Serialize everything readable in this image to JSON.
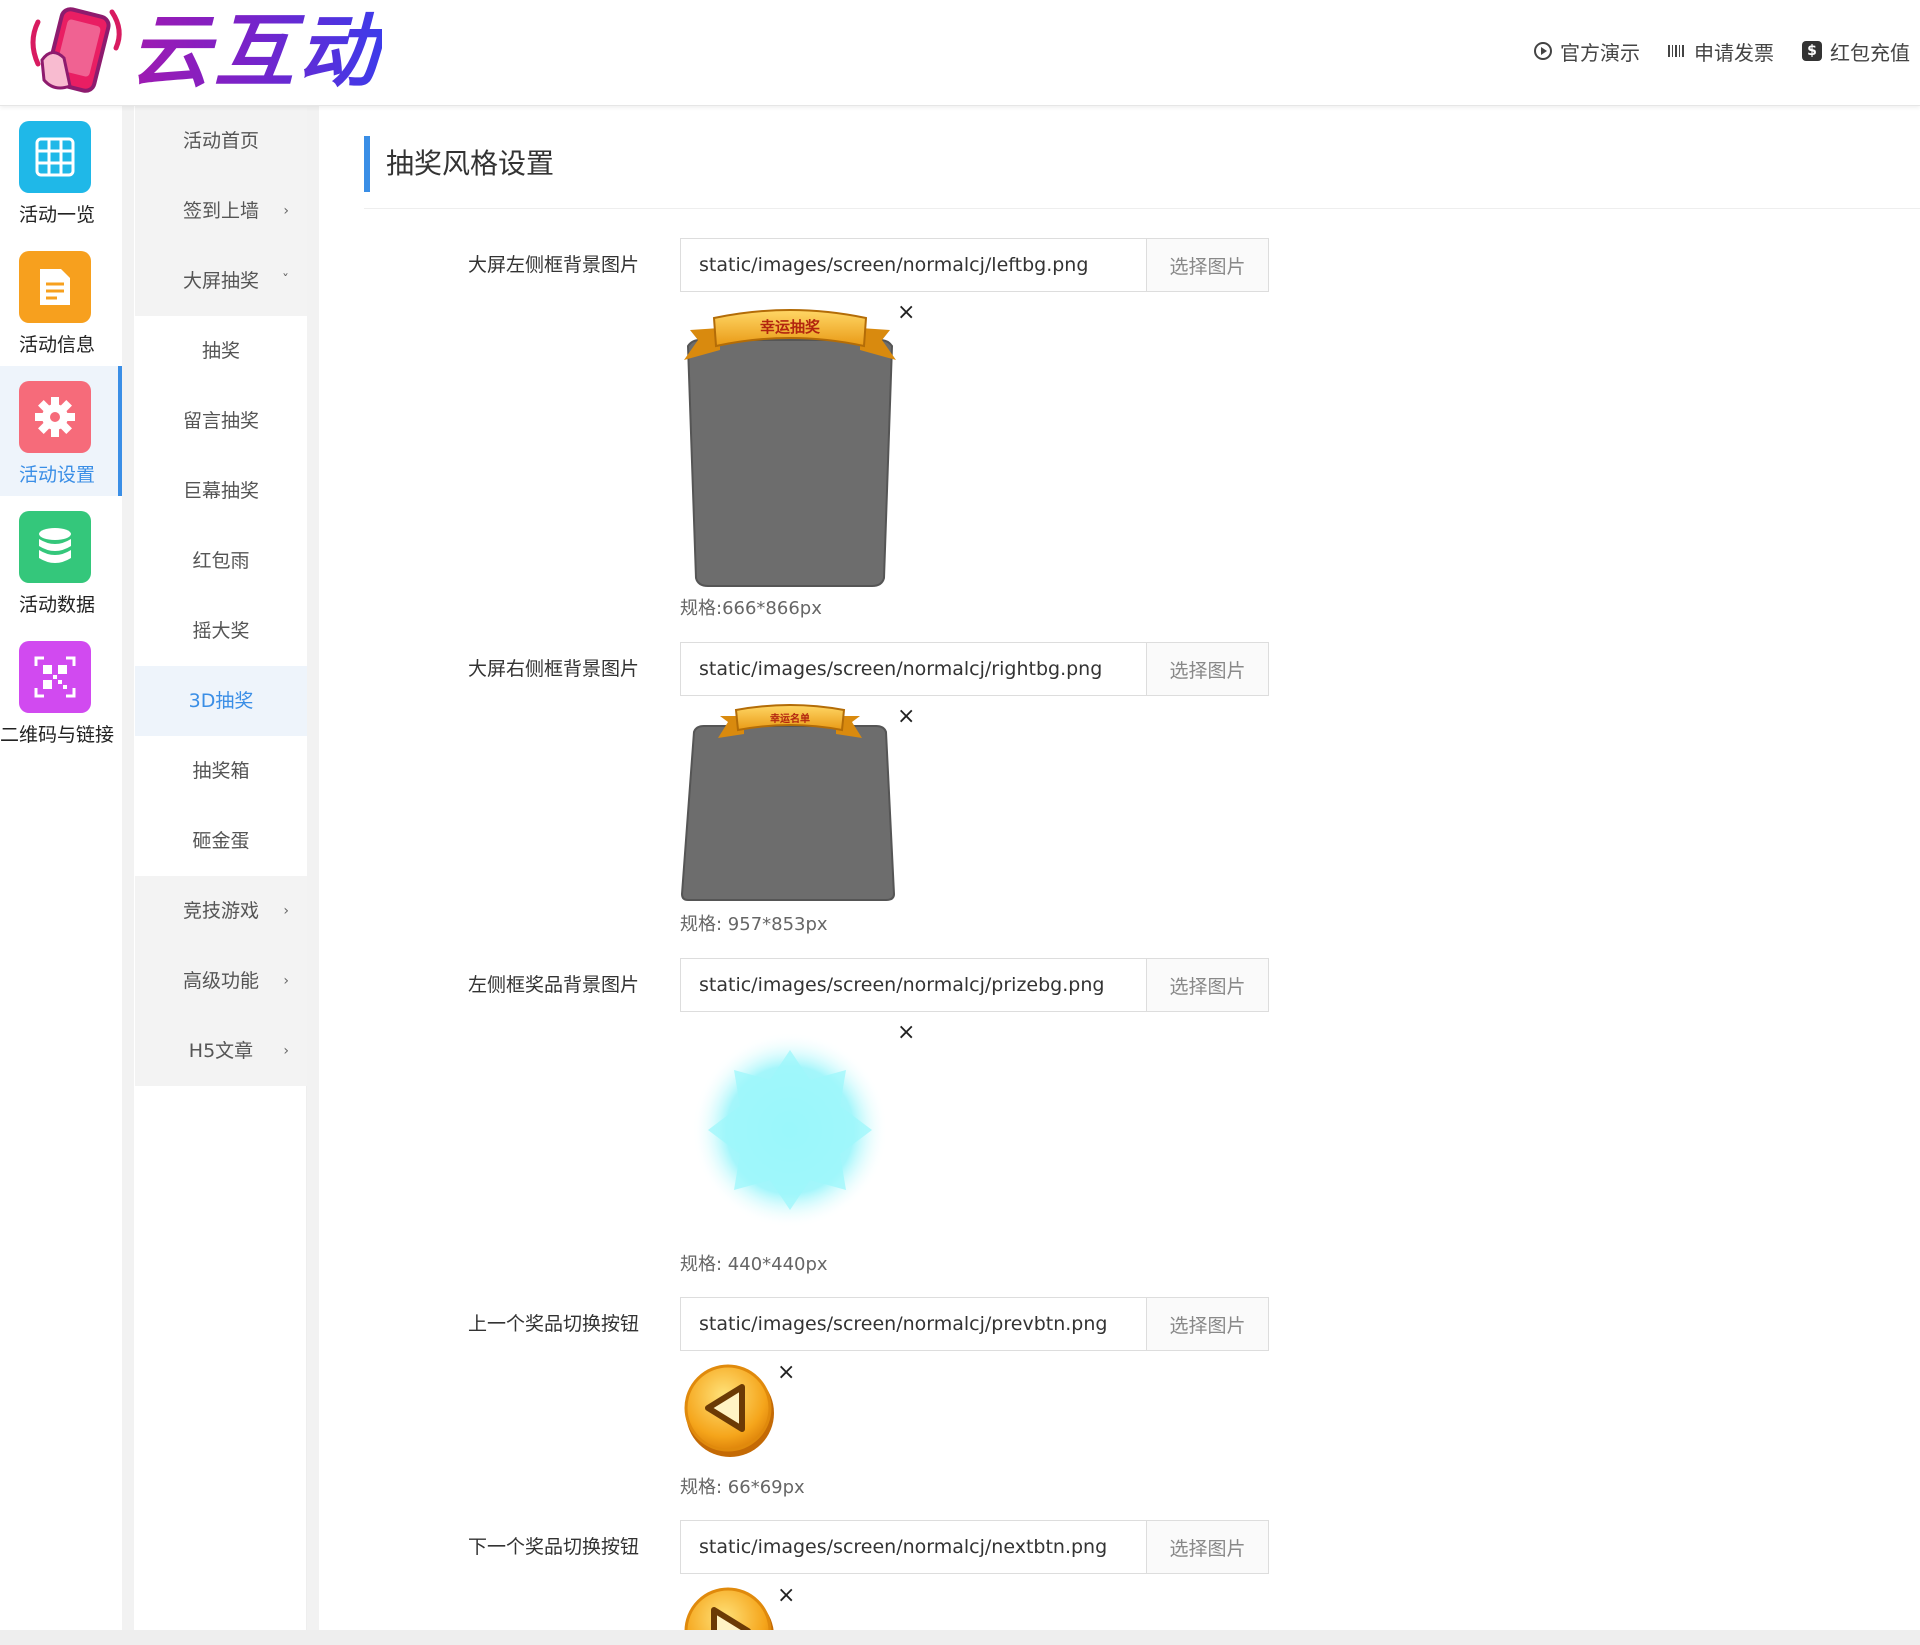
{
  "brand": {
    "logo_text": "云互动"
  },
  "top_links": [
    {
      "label": "官方演示",
      "icon": "play-circle-icon"
    },
    {
      "label": "申请发票",
      "icon": "barcode-icon"
    },
    {
      "label": "红包充值",
      "icon": "dollar-icon"
    }
  ],
  "iconbar": [
    {
      "label": "活动一览",
      "icon": "grid-icon",
      "color": "#1fb8e8"
    },
    {
      "label": "活动信息",
      "icon": "document-icon",
      "color": "#f7a01e"
    },
    {
      "label": "活动设置",
      "icon": "gear-icon",
      "color": "#f66b7a",
      "active": true
    },
    {
      "label": "活动数据",
      "icon": "database-icon",
      "color": "#34c77b"
    },
    {
      "label": "二维码与链接",
      "icon": "qrcode-icon",
      "color": "#d14af0"
    }
  ],
  "submenu": [
    {
      "label": "活动首页",
      "type": "group"
    },
    {
      "label": "签到上墙",
      "type": "group",
      "arrow": "›"
    },
    {
      "label": "大屏抽奖",
      "type": "group",
      "arrow": "ˇ"
    },
    {
      "label": "抽奖",
      "type": "child"
    },
    {
      "label": "留言抽奖",
      "type": "child"
    },
    {
      "label": "巨幕抽奖",
      "type": "child"
    },
    {
      "label": "红包雨",
      "type": "child"
    },
    {
      "label": "摇大奖",
      "type": "child"
    },
    {
      "label": "3D抽奖",
      "type": "child",
      "active": true
    },
    {
      "label": "抽奖箱",
      "type": "child"
    },
    {
      "label": "砸金蛋",
      "type": "child"
    },
    {
      "label": "竞技游戏",
      "type": "group",
      "arrow": "›"
    },
    {
      "label": "高级功能",
      "type": "group",
      "arrow": "›"
    },
    {
      "label": "H5文章",
      "type": "group",
      "arrow": "›"
    }
  ],
  "page": {
    "title": "抽奖风格设置",
    "pick_label": "选择图片",
    "close_glyph": "×",
    "fields": [
      {
        "label": "大屏左侧框背景图片",
        "value": "static/images/screen/normalcj/leftbg.png",
        "spec": "规格:666*866px",
        "banner": "幸运抽奖"
      },
      {
        "label": "大屏右侧框背景图片",
        "value": "static/images/screen/normalcj/rightbg.png",
        "spec": "规格: 957*853px",
        "banner": "幸运名单"
      },
      {
        "label": "左侧框奖品背景图片",
        "value": "static/images/screen/normalcj/prizebg.png",
        "spec": "规格: 440*440px"
      },
      {
        "label": "上一个奖品切换按钮",
        "value": "static/images/screen/normalcj/prevbtn.png",
        "spec": "规格: 66*69px"
      },
      {
        "label": "下一个奖品切换按钮",
        "value": "static/images/screen/normalcj/nextbtn.png"
      }
    ]
  }
}
